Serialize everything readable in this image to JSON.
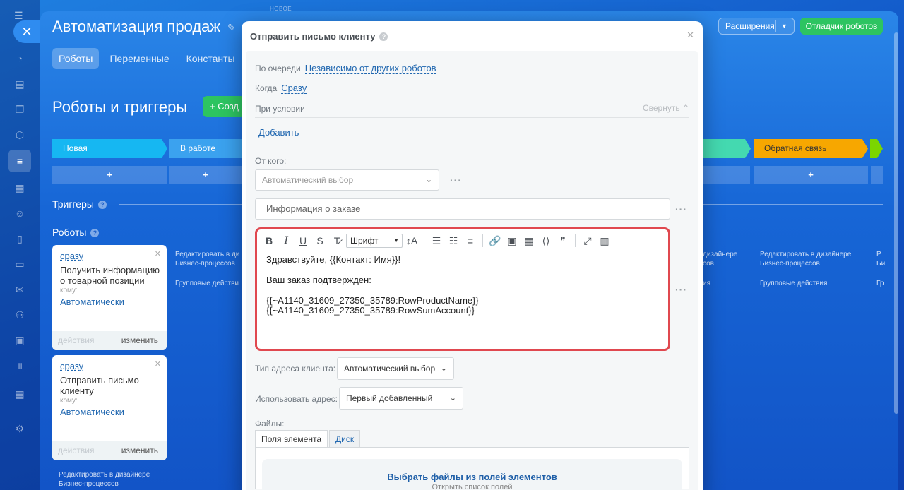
{
  "app": {
    "title": "Автоматизация продаж",
    "new_badge": "НОВОЕ",
    "tabs": [
      "Роботы",
      "Переменные",
      "Константы"
    ],
    "extensions_label": "Расширения",
    "debugger_label": "Отладчик роботов",
    "section_title": "Роботы и триггеры",
    "create_label": "Созд"
  },
  "stages": {
    "new": "Новая",
    "in_progress": "В работе",
    "feedback": "Обратная связь",
    "plus": "+"
  },
  "labels": {
    "triggers": "Триггеры",
    "robots": "Роботы"
  },
  "cards": [
    {
      "when": "сразу",
      "name": "Получить информацию о товарной позиции",
      "who": "кому:",
      "target": "Автоматически",
      "actions": "действия",
      "edit": "изменить"
    },
    {
      "when": "сразу",
      "name": "Отправить письмо клиенту",
      "who": "кому:",
      "target": "Автоматически",
      "actions": "действия",
      "edit": "изменить"
    }
  ],
  "side": {
    "edit_designer": "Редактировать в дизайнере Бизнес-процессов",
    "group_actions": "Групповые действия",
    "edit_designer_short": "Редактировать в ди Бизнес-процессов",
    "group_actions_short": "Групповые действи",
    "frag_p": "дизайнере",
    "frag_s": "сов",
    "frag_ia": "ия",
    "frag_r": "Р",
    "frag_bi": "Би",
    "frag_gr": "Гр"
  },
  "modal": {
    "title": "Отправить письмо клиенту",
    "queue_label": "По очереди",
    "queue_value": "Независимо от других роботов",
    "when_label": "Когда",
    "when_value": "Сразу",
    "condition_label": "При условии",
    "collapse_label": "Свернуть",
    "add_label": "Добавить",
    "from_label": "От кого:",
    "from_placeholder": "Автоматический выбор",
    "subject_value": "Информация о заказе",
    "font_label": "Шрифт",
    "body_lines": [
      "Здравствуйте, {{Контакт: Имя}}!",
      "Ваш заказ подтвержден:",
      "{{~A1140_31609_27350_35789:RowProductName}}",
      "{{~A1140_31609_27350_35789:RowSumAccount}}"
    ],
    "addr_type_label": "Тип адреса клиента:",
    "addr_type_value": "Автоматический выбор",
    "use_addr_label": "Использовать адрес:",
    "use_addr_value": "Первый добавленный",
    "files_label": "Файлы:",
    "files_tabs": [
      "Поля элемента",
      "Диск"
    ],
    "files_title": "Выбрать файлы из полей элементов",
    "files_sub": "Открыть список полей"
  },
  "colors": {
    "accent": "#2dc461",
    "link": "#2067b0",
    "highlight": "#e0484f",
    "stage_new": "#16b7f2",
    "stage_work": "#3ba2ef",
    "stage_feedback": "#f7a700",
    "stage_green": "#44d9b0",
    "stage_lime": "#7bd500"
  }
}
